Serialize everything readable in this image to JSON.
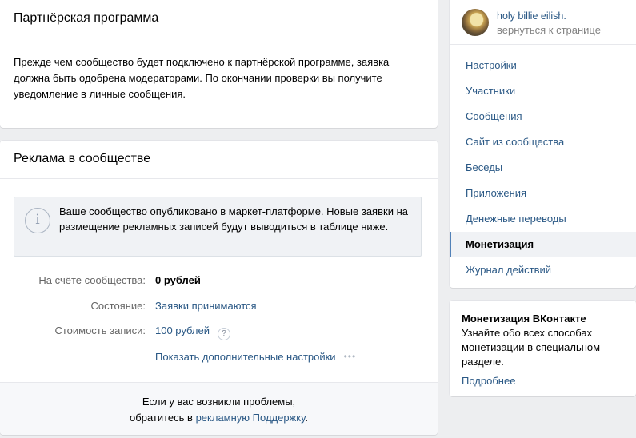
{
  "partner": {
    "title": "Партнёрская программа",
    "text": "Прежде чем сообщество будет подключено к партнёрской программе, заявка должна быть одобрена модераторами. По окончании проверки вы получите уведомление в личные сообщения."
  },
  "ads": {
    "title": "Реклама в сообществе",
    "info_icon": "info-icon",
    "info_text": "Ваше сообщество опубликовано в маркет-платформе. Новые заявки на размещение рекламных записей будут выводиться в таблице ниже.",
    "balance_label": "На счёте сообщества:",
    "balance_value": "0 рублей",
    "status_label": "Состояние:",
    "status_value": "Заявки принимаются",
    "price_label": "Стоимость записи:",
    "price_value": "100 рублей",
    "help_icon": "?",
    "more_settings": "Показать дополнительные настройки",
    "more_icon": "•••",
    "footer_line1": "Если у вас возникли проблемы,",
    "footer_line2_prefix": "обратитесь в ",
    "footer_link": "рекламную Поддержку",
    "footer_suffix": "."
  },
  "profile": {
    "name": "holy billie eilish.",
    "back": "вернуться к странице"
  },
  "menu": {
    "items": [
      {
        "label": "Настройки",
        "active": false
      },
      {
        "label": "Участники",
        "active": false
      },
      {
        "label": "Сообщения",
        "active": false
      },
      {
        "label": "Сайт из сообщества",
        "active": false
      },
      {
        "label": "Беседы",
        "active": false
      },
      {
        "label": "Приложения",
        "active": false
      },
      {
        "label": "Денежные переводы",
        "active": false
      },
      {
        "label": "Монетизация",
        "active": true
      },
      {
        "label": "Журнал действий",
        "active": false
      }
    ]
  },
  "promo": {
    "title": "Монетизация ВКонтакте",
    "text": "Узнайте обо всех способах монетизации в специальном разделе.",
    "link": "Подробнее"
  },
  "colors": {
    "link": "#2a5885",
    "background": "#edeef0",
    "active_marker": "#5181b8"
  }
}
